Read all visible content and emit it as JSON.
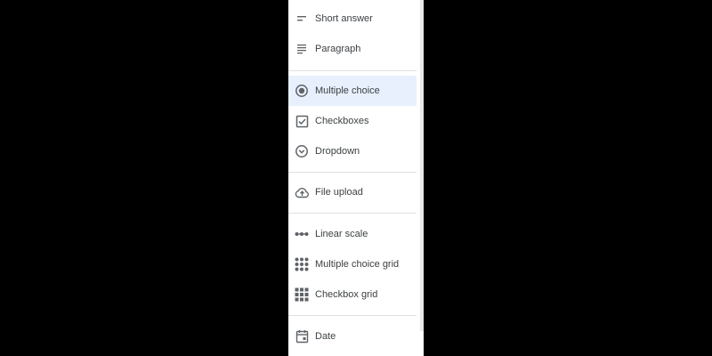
{
  "menu": {
    "items": [
      {
        "label": "Short answer",
        "icon": "short-answer-icon"
      },
      {
        "label": "Paragraph",
        "icon": "paragraph-icon"
      },
      {
        "label": "Multiple choice",
        "icon": "radio-button-icon",
        "selected": true
      },
      {
        "label": "Checkboxes",
        "icon": "checkbox-icon"
      },
      {
        "label": "Dropdown",
        "icon": "dropdown-icon"
      },
      {
        "label": "File upload",
        "icon": "cloud-upload-icon"
      },
      {
        "label": "Linear scale",
        "icon": "linear-scale-icon"
      },
      {
        "label": "Multiple choice grid",
        "icon": "dots-grid-icon"
      },
      {
        "label": "Checkbox grid",
        "icon": "checkbox-grid-icon"
      },
      {
        "label": "Date",
        "icon": "calendar-icon"
      }
    ]
  },
  "colors": {
    "background": "#000000",
    "menu_background": "#ffffff",
    "selected_background": "#e8f0fe",
    "text": "#3c4043",
    "icon": "#5f6368",
    "divider": "#e0e0e0"
  }
}
